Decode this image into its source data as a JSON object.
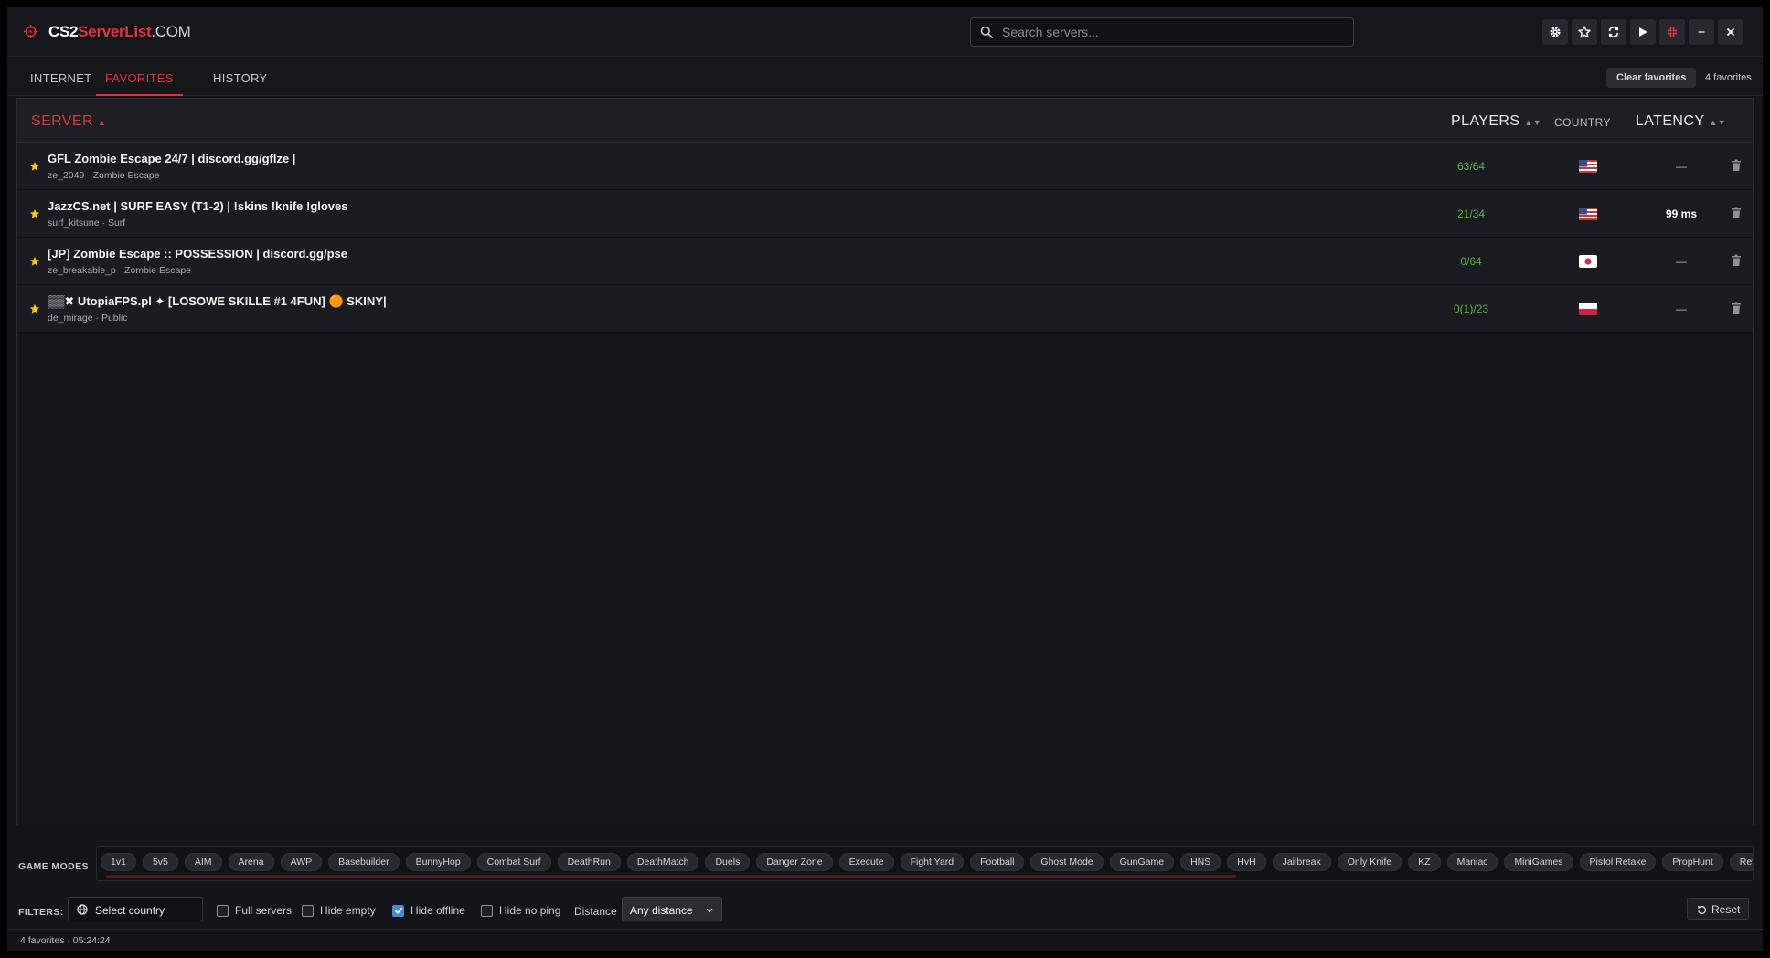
{
  "app": {
    "logo": {
      "part1": "CS2",
      "part2": "ServerList",
      "part3": ".COM"
    },
    "accent_color": "#e0343f"
  },
  "search": {
    "placeholder": "Search servers..."
  },
  "toolbar": {
    "icons": [
      "gear-icon",
      "star-icon",
      "refresh-icon",
      "play-icon",
      "compress-icon",
      "minimize-icon",
      "close-icon"
    ]
  },
  "tabs": [
    {
      "label": "INTERNET",
      "active": false
    },
    {
      "label": "FAVORITES",
      "active": true
    },
    {
      "label": "HISTORY",
      "active": false
    }
  ],
  "favorites": {
    "clear_label": "Clear favorites",
    "count_label": "4 favorites"
  },
  "table": {
    "headers": {
      "server": "SERVER",
      "players": "PLAYERS",
      "country": "COUNTRY",
      "latency": "LATENCY"
    },
    "rows": [
      {
        "name": "GFL Zombie Escape 24/7 | discord.gg/gflze |",
        "map": "ze_2049 · Zombie Escape",
        "players": "63/64",
        "country": "us",
        "latency": "—"
      },
      {
        "name": "JazzCS.net | SURF EASY (T1-2) | !skins !knife !gloves",
        "map": "surf_kitsune · Surf",
        "players": "21/34",
        "country": "us",
        "latency": "99 ms"
      },
      {
        "name": "[JP] Zombie Escape :: POSSESSION | discord.gg/pse",
        "map": "ze_breakable_p · Zombie Escape",
        "players": "0/64",
        "country": "jp",
        "latency": "—"
      },
      {
        "name": "▒▒✖ UtopiaFPS.pl ✦ [LOSOWE SKILLE #1 4FUN] 🟠 SKINY|",
        "map": "de_mirage · Public",
        "players": "0(1)/23",
        "country": "pl",
        "latency": "—"
      }
    ]
  },
  "game_modes": {
    "label": "GAME MODES",
    "items": [
      "1v1",
      "5v5",
      "AIM",
      "Arena",
      "AWP",
      "Basebuilder",
      "BunnyHop",
      "Combat Surf",
      "DeathRun",
      "DeathMatch",
      "Duels",
      "Danger Zone",
      "Execute",
      "Fight Yard",
      "Football",
      "Ghost Mode",
      "GunGame",
      "HNS",
      "HvH",
      "Jailbreak",
      "Only Knife",
      "KZ",
      "Maniac",
      "MiniGames",
      "Pistol Retake",
      "PropHunt",
      "Retake"
    ]
  },
  "filters": {
    "label": "FILTERS:",
    "country_placeholder": "Select country",
    "full_servers": {
      "label": "Full servers",
      "checked": false
    },
    "hide_empty": {
      "label": "Hide empty",
      "checked": false
    },
    "hide_offline": {
      "label": "Hide offline",
      "checked": true
    },
    "hide_no_ping": {
      "label": "Hide no ping",
      "checked": false
    },
    "distance_label": "Distance",
    "distance_value": "Any distance",
    "reset_label": "Reset"
  },
  "status": {
    "text": "4 favorites · 05:24:24"
  }
}
